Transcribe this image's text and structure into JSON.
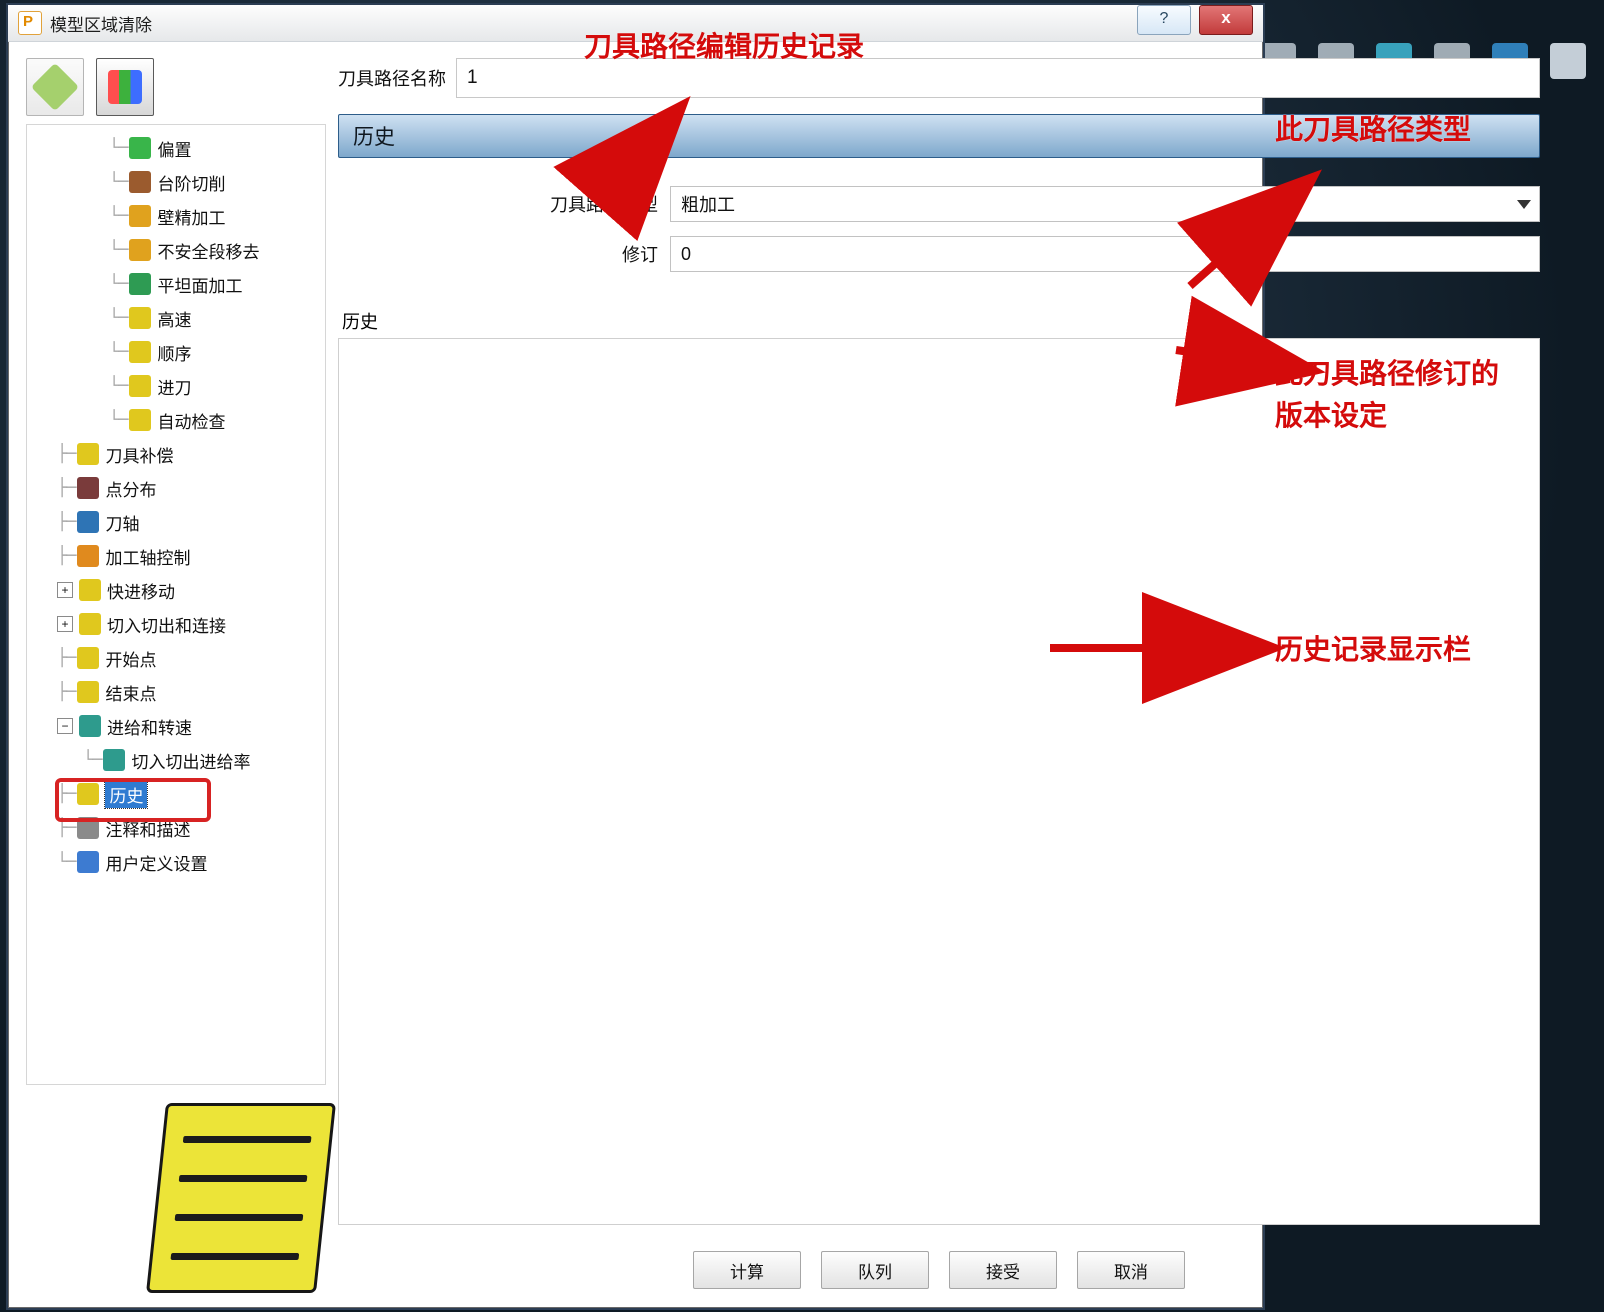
{
  "window": {
    "title": "模型区域清除",
    "help_symbol": "?",
    "close_symbol": "x"
  },
  "toolbar_icons": [
    "cube-icon",
    "stack-icon",
    "lines-icon",
    "rotate-icon",
    "pin-icon",
    "eraser-icon"
  ],
  "mode_buttons": {
    "a_name": "mode-rotate-icon",
    "b_name": "mode-layers-icon"
  },
  "toolpath_name": {
    "label": "刀具路径名称",
    "value": "1"
  },
  "section_header": "历史",
  "form": {
    "type_label": "刀具路径类型",
    "type_value": "粗加工",
    "revision_label": "修订",
    "revision_value": "0"
  },
  "history_label": "历史",
  "buttons": {
    "calc": "计算",
    "queue": "队列",
    "accept": "接受",
    "cancel": "取消"
  },
  "tree": [
    {
      "d": 3,
      "c": "└",
      "ico": "#39b54a",
      "label": "偏置"
    },
    {
      "d": 3,
      "c": "└",
      "ico": "#9b5b2e",
      "label": "台阶切削"
    },
    {
      "d": 3,
      "c": "└",
      "ico": "#e0a21e",
      "label": "壁精加工"
    },
    {
      "d": 3,
      "c": "└",
      "ico": "#e0a21e",
      "label": "不安全段移去"
    },
    {
      "d": 3,
      "c": "└",
      "ico": "#2e9b53",
      "label": "平坦面加工"
    },
    {
      "d": 3,
      "c": "└",
      "ico": "#e0c81e",
      "label": "高速"
    },
    {
      "d": 3,
      "c": "└",
      "ico": "#e0c81e",
      "label": "顺序"
    },
    {
      "d": 3,
      "c": "└",
      "ico": "#e0c81e",
      "label": "进刀"
    },
    {
      "d": 3,
      "c": "└",
      "ico": "#e0c81e",
      "label": "自动检查"
    },
    {
      "d": 1,
      "c": "├",
      "ico": "#e0c81e",
      "label": "刀具补偿"
    },
    {
      "d": 1,
      "c": "├",
      "ico": "#7a3b3b",
      "label": "点分布"
    },
    {
      "d": 1,
      "c": "├",
      "ico": "#2e74b5",
      "label": "刀轴"
    },
    {
      "d": 1,
      "c": "├",
      "ico": "#e08a1e",
      "label": "加工轴控制"
    },
    {
      "d": 1,
      "c": "├",
      "exp": "+",
      "ico": "#e0c81e",
      "label": "快进移动"
    },
    {
      "d": 1,
      "c": "├",
      "exp": "+",
      "ico": "#e0c81e",
      "label": "切入切出和连接"
    },
    {
      "d": 1,
      "c": "├",
      "ico": "#e0c81e",
      "label": "开始点"
    },
    {
      "d": 1,
      "c": "├",
      "ico": "#e0c81e",
      "label": "结束点"
    },
    {
      "d": 1,
      "c": "├",
      "exp": "−",
      "ico": "#2e9b8d",
      "label": "进给和转速"
    },
    {
      "d": 2,
      "c": "└",
      "ico": "#2e9b8d",
      "label": "切入切出进给率"
    },
    {
      "d": 1,
      "c": "├",
      "ico": "#e0c81e",
      "label": "历史",
      "selected": true
    },
    {
      "d": 1,
      "c": "├",
      "ico": "#8a8a8a",
      "label": "注释和描述"
    },
    {
      "d": 1,
      "c": "└",
      "ico": "#3d7bd1",
      "label": "用户定义设置"
    }
  ],
  "annotations": {
    "top": "刀具路径编辑历史记录",
    "type": "此刀具路径类型",
    "rev1": "此刀具路径修订的",
    "rev2": "版本设定",
    "hist": "历史记录显示栏"
  }
}
